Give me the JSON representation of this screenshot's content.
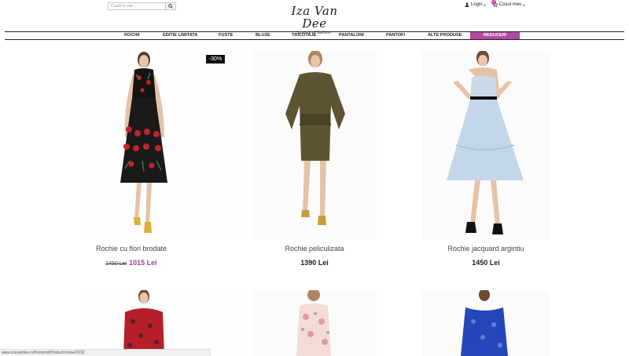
{
  "header": {
    "search_placeholder": "Caută în site...",
    "logo_main": "Iza Van Dee",
    "logo_sub": "a story of fashion",
    "login_label": "Login",
    "cart_label": "Coșul meu",
    "cart_count": "0"
  },
  "nav": {
    "items": [
      {
        "label": "ROCHII"
      },
      {
        "label": "EDITIE LIMITATA"
      },
      {
        "label": "FUSTE"
      },
      {
        "label": "BLUZE"
      },
      {
        "label": "TRICOTAJE"
      },
      {
        "label": "PANTALONI"
      },
      {
        "label": "PANTOFI"
      },
      {
        "label": "ALTE PRODUSE"
      },
      {
        "label": "REDUCERI"
      }
    ]
  },
  "products": [
    {
      "name": "Rochie cu flori brodate",
      "old_price": "1450 Lei",
      "price": "1015 Lei",
      "badge": "-30%"
    },
    {
      "name": "Rochie peliculizata",
      "price": "1390 Lei"
    },
    {
      "name": "Rochie jacquard argintiu",
      "price": "1450 Lei"
    }
  ],
  "status_bar": {
    "url": "www.izavandee.ro/frontend/Producto/view/2032"
  },
  "colors": {
    "accent": "#b04a9e",
    "sale": "#a3418f"
  }
}
